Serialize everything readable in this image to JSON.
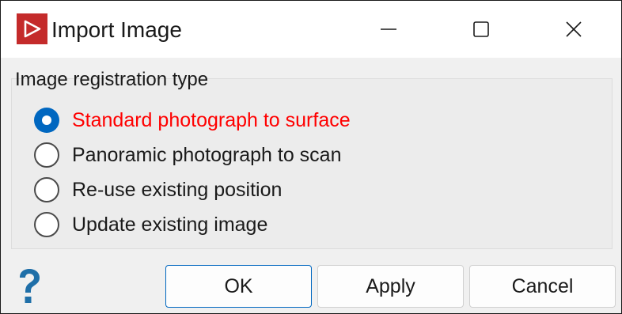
{
  "window": {
    "title": "Import Image",
    "icon": "app-logo-icon",
    "controls": [
      "minimize-icon",
      "maximize-icon",
      "close-icon"
    ]
  },
  "registration": {
    "group_label": "Image registration type",
    "options": [
      {
        "label": "Standard photograph to surface",
        "checked": true
      },
      {
        "label": "Panoramic photograph to scan",
        "checked": false
      },
      {
        "label": "Re-use existing position",
        "checked": false
      },
      {
        "label": "Update existing image",
        "checked": false
      }
    ]
  },
  "footer": {
    "help_icon": "help-icon",
    "ok_label": "OK",
    "apply_label": "Apply",
    "cancel_label": "Cancel"
  },
  "colors": {
    "accent": "#0067c0",
    "selected_text": "#ff0000",
    "app_icon": "#c42b2b"
  }
}
